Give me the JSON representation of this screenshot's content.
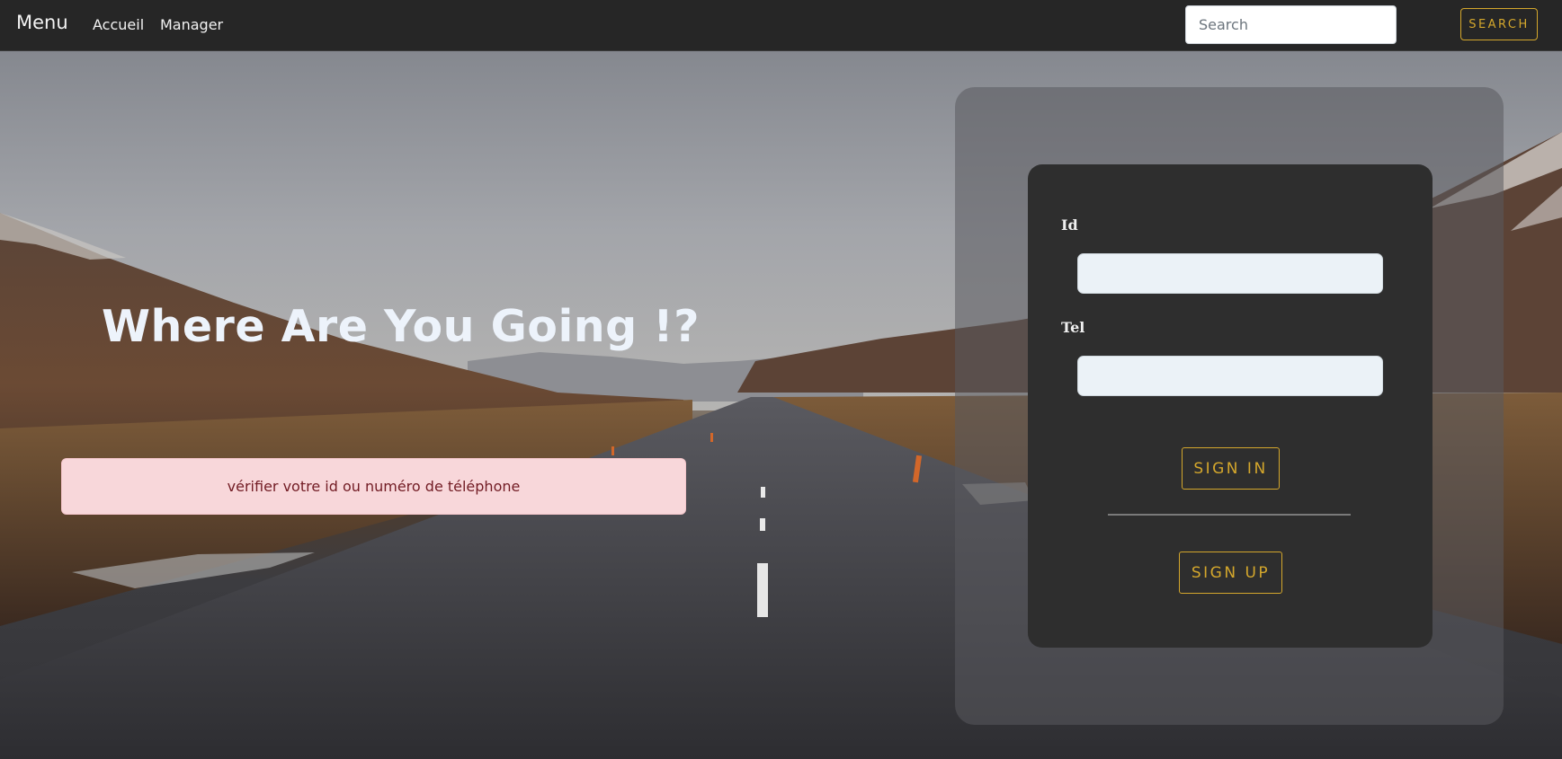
{
  "navbar": {
    "brand": "Menu",
    "links": [
      {
        "label": "Accueil"
      },
      {
        "label": "Manager"
      }
    ],
    "search_placeholder": "Search",
    "search_button": "SEARCH"
  },
  "hero": {
    "title": "Where Are You Going !?",
    "alert": "vérifier votre id ou numéro de téléphone"
  },
  "login": {
    "id_label": "Id",
    "id_value": "",
    "tel_label": "Tel",
    "tel_value": "",
    "signin_button": "SIGN IN",
    "signup_button": "SIGN UP"
  },
  "colors": {
    "navbar_bg": "#262626",
    "accent_gold": "#d4a72c",
    "alert_bg": "#f8d7da",
    "alert_text": "#721c24",
    "card_bg": "#2e2e2e"
  }
}
